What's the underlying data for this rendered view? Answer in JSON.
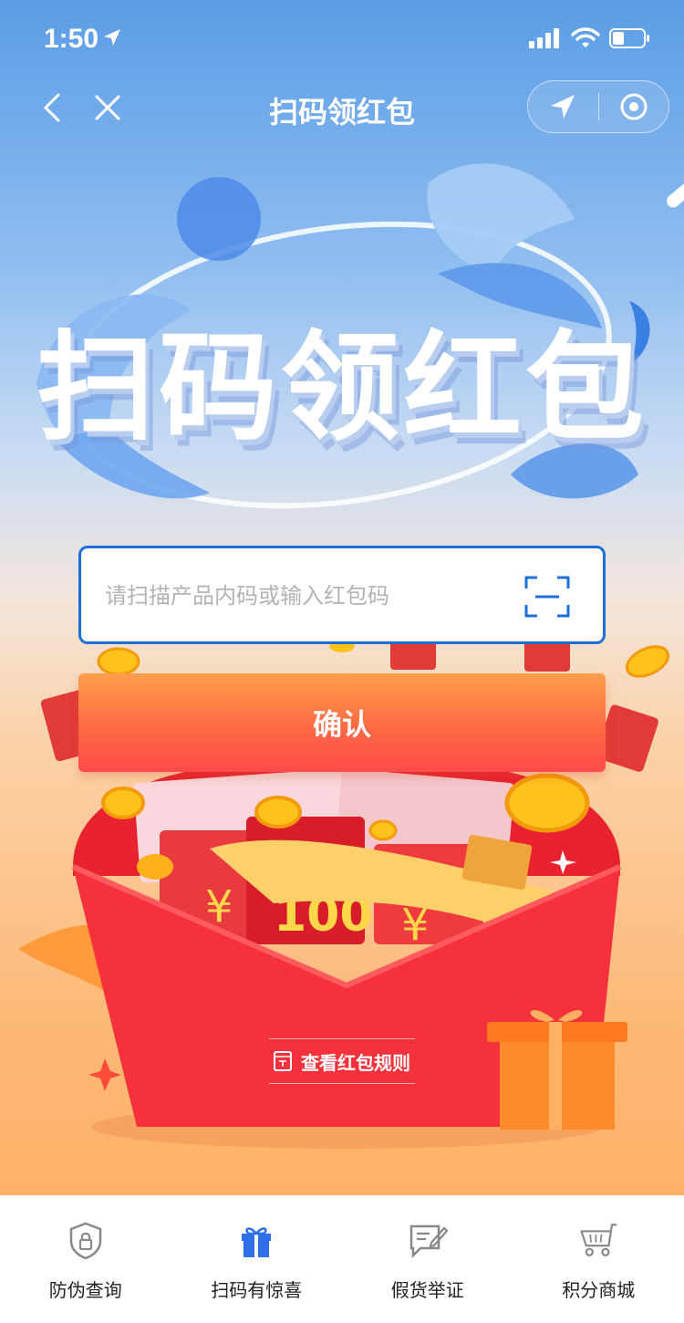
{
  "status_bar": {
    "time": "1:50"
  },
  "nav": {
    "title": "扫码领红包"
  },
  "hero": {
    "title": "扫码领红包"
  },
  "code_input": {
    "placeholder": "请扫描产品内码或输入红包码",
    "value": ""
  },
  "confirm_label": "确认",
  "rules_label": "查看红包规则",
  "decor": {
    "ticket_text": "100"
  },
  "tabs": [
    {
      "label": "防伪查询",
      "icon": "shield-lock-icon"
    },
    {
      "label": "扫码有惊喜",
      "icon": "gift-icon"
    },
    {
      "label": "假货举证",
      "icon": "report-pen-icon"
    },
    {
      "label": "积分商城",
      "icon": "cart-icon"
    }
  ],
  "colors": {
    "primary_blue": "#1c6fd6",
    "confirm_orange": "#ff7a45",
    "envelope_red": "#f5323b",
    "active_tab_icon": "#2f6fe8"
  }
}
